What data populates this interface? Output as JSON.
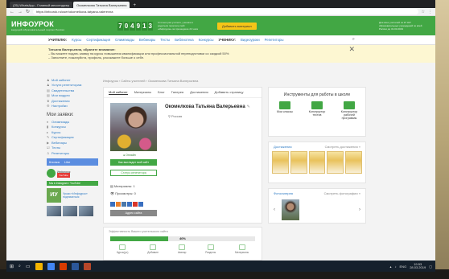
{
  "browser": {
    "tabs": [
      {
        "label": "(25) WhatsApp - Главный мессенджер"
      },
      {
        "label": "Окомелкова Татьяна Валерьевна",
        "active": true
      }
    ],
    "url": "https://infourok.ru/user/okomelkova-tatyana-valerevna"
  },
  "site": {
    "logo": "ИНФОУРОК",
    "logo_tagline": "ведущий образовательный портал России",
    "counter_digits": [
      "7",
      "0",
      "4",
      "9",
      "1",
      "3"
    ],
    "counter_caption": "Столько раз учителя, ученики и родители посетили сайт «Инфоурок» за прошедшие 24 часа",
    "add_material": "Добавить материал",
    "mail_caption": "Для всех учителей из 37 347 образовательных учреждений по всей России до 31.03.2019",
    "menu_left_label": "УЧИТЕЛЮ:",
    "menu_left": [
      "Курсы",
      "Сертификация",
      "Олимпиады",
      "Вебинары",
      "Тесты",
      "Библиотека",
      "Конкурсы"
    ],
    "menu_right_label": "УЧЕНИКУ:",
    "menu_right": [
      "Видеоуроки",
      "Репетиторы"
    ]
  },
  "notice": {
    "greeting": "Татьяна Валерьевна, обратите внимание:",
    "line1": "– Вы можете подать заявку на курсы повышения квалификации или профессиональной переподготовки со скидкой 50%",
    "line2": "– Заполните, пожалуйста, профиль, расскажите больше о себе."
  },
  "sidebar": {
    "items": [
      {
        "icon": "user",
        "label": "Мой кабинет"
      },
      {
        "icon": "user",
        "label": "Услуги репетиторам"
      },
      {
        "icon": "doc",
        "label": "Свидетельства"
      },
      {
        "icon": "doc",
        "label": "Мои модули"
      },
      {
        "icon": "trophy",
        "label": "Достижения"
      },
      {
        "icon": "gear",
        "label": "Настройки"
      }
    ],
    "title": "Мои заявки:",
    "requests": [
      {
        "label": "Олимпиады"
      },
      {
        "label": "Конкурсы"
      },
      {
        "label": "Курсы"
      },
      {
        "label": "Сертификация"
      },
      {
        "label": "Вебинары"
      },
      {
        "label": "Тесты"
      },
      {
        "label": "Репетиторы"
      }
    ],
    "share_label": "Кнопка",
    "share_label2": "Like",
    "infourok_name": "Инфоурок",
    "youtube": "YouTube",
    "iu_strip": "Мы в Instagram / YouTube",
    "iu_name": "Уроки «Инфоурок»",
    "iu_sub": "подписаться"
  },
  "profile": {
    "breadcrumb": "Инфоурок › Сайты учителей › Окомелкова Татьяна Валерьевна",
    "tabs": [
      "Мой кабинет",
      "Материалы",
      "Блог",
      "Галерея",
      "Достижения",
      "Добавить страницу"
    ],
    "name": "Окомелкова Татьяна Валерьевна",
    "city": "Россия",
    "online": "Онлайн",
    "btn_create": "Как выглядит мой сайт",
    "btn_edit": "Статус репетитора",
    "materials": "Материалы: 1",
    "views": "Просмотры: 0",
    "btn_address": "Адрес сайта"
  },
  "efficiency": {
    "title": "Эффективность Вашего учительского сайта",
    "value": "40%",
    "fraction": 0.4,
    "icons": [
      "Курсы(уч)",
      "Добавьте",
      "Аватар",
      "Разделы",
      "Материалы"
    ]
  },
  "tools": {
    "title": "Инструменты для работы в школе",
    "items": [
      "Мои классы",
      "Конструктор тестов",
      "Конструктор рабочей программы"
    ]
  },
  "achievements": {
    "title": "Достижения",
    "link": "Смотреть достижения »"
  },
  "gallery": {
    "title": "Фотогалерея",
    "link": "Смотреть фотографии »"
  },
  "taskbar": {
    "lang": "ENG",
    "time": "19:53",
    "date": "28.03.2019"
  }
}
